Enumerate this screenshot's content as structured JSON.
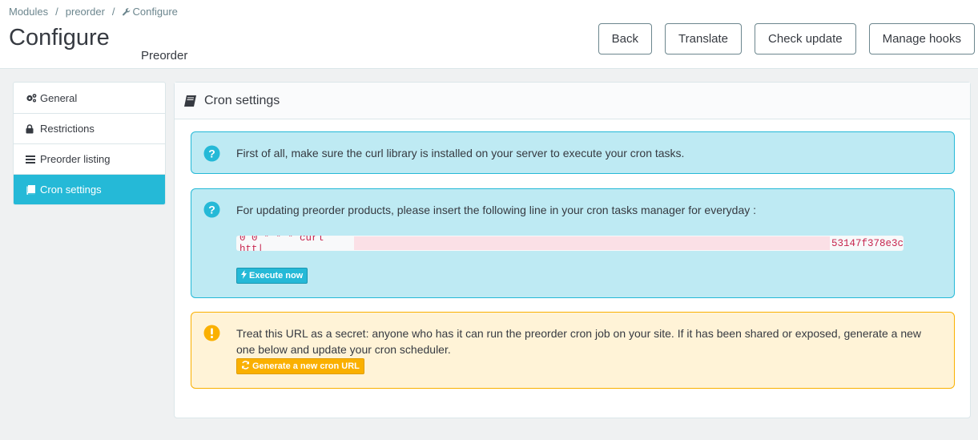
{
  "breadcrumb": {
    "items": [
      "Modules",
      "preorder",
      "Configure"
    ],
    "separator": "/"
  },
  "header": {
    "title": "Configure",
    "subtitle": "Preorder"
  },
  "toolbar": {
    "back": "Back",
    "translate": "Translate",
    "check_update": "Check update",
    "manage_hooks": "Manage hooks"
  },
  "sidebar": {
    "items": [
      {
        "label": "General",
        "icon": "cogs-icon"
      },
      {
        "label": "Restrictions",
        "icon": "lock-icon"
      },
      {
        "label": "Preorder listing",
        "icon": "list-icon"
      },
      {
        "label": "Cron settings",
        "icon": "book-icon",
        "active": true
      }
    ]
  },
  "panel": {
    "title": "Cron settings",
    "info_curl": "First of all, make sure the curl library is installed on your server to execute your cron tasks.",
    "info_cron": "For updating preorder products, please insert the following line in your cron tasks manager for everyday :",
    "cron_line_prefix": "0 0 * * * curl htt|",
    "cron_line_suffix": "53147f378e3c",
    "execute_label": "Execute now",
    "warning_text": "Treat this URL as a secret: anyone who has it can run the preorder cron job on your site. If it has been shared or exposed, generate a new one below and update your cron scheduler.",
    "generate_label": "Generate a new cron URL"
  },
  "colors": {
    "primary": "#25b9d7",
    "info_bg": "#beeaf3",
    "warning": "#fab000",
    "warning_bg": "#fff3d7",
    "code": "#c7254e"
  }
}
